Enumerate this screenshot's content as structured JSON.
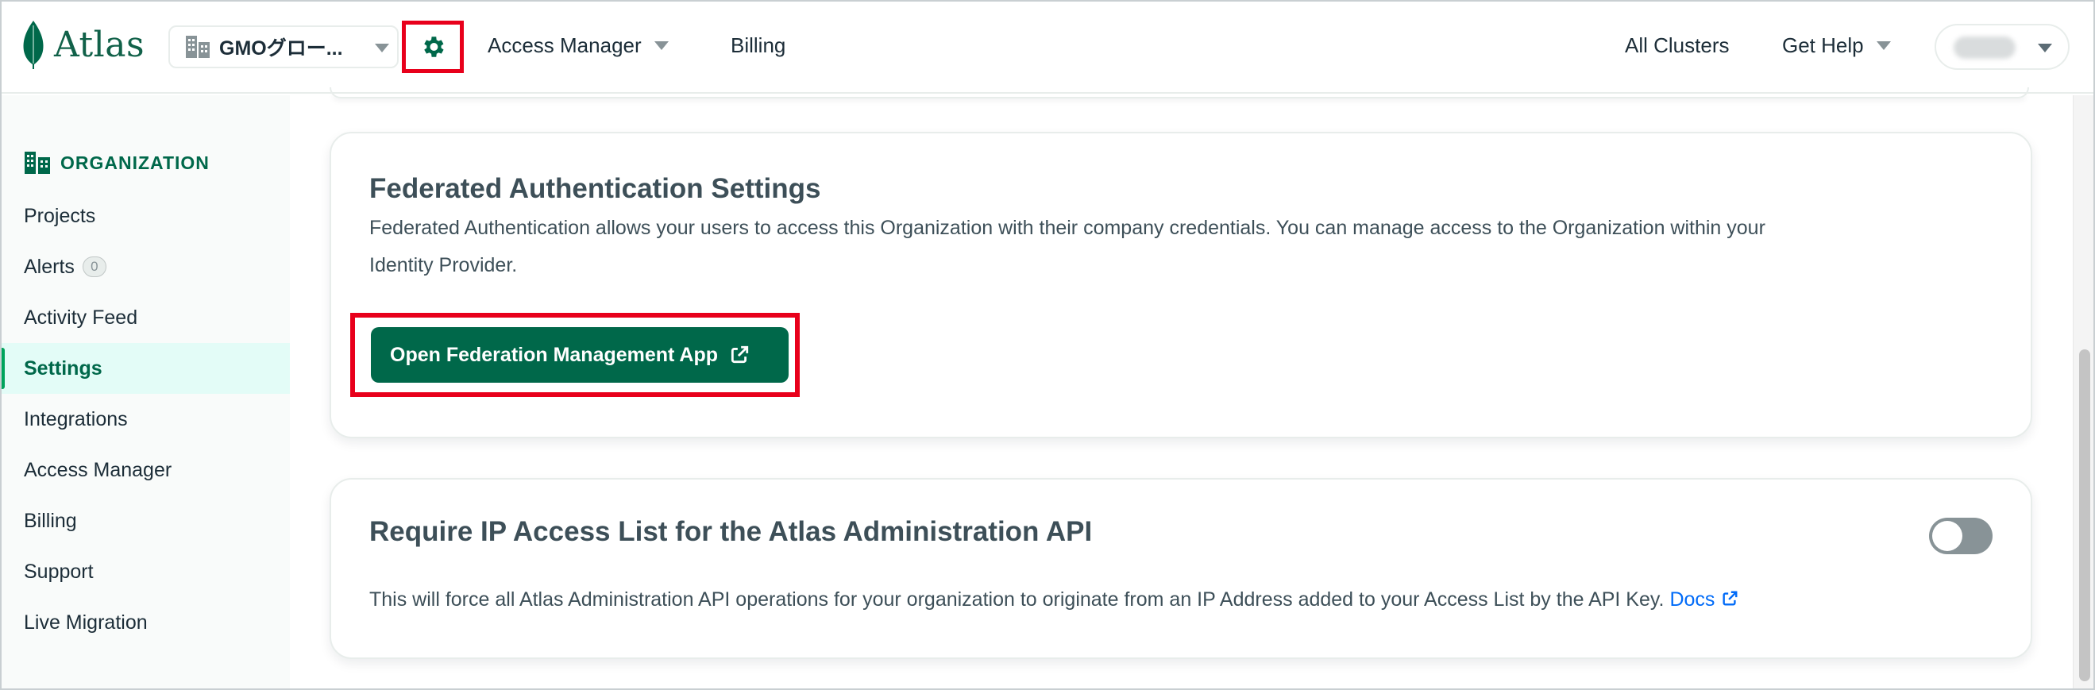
{
  "header": {
    "logo_text": "Atlas",
    "org_name": "GMOグロー...",
    "nav": {
      "access_manager": "Access Manager",
      "billing": "Billing",
      "all_clusters": "All Clusters",
      "get_help": "Get Help"
    }
  },
  "sidebar": {
    "heading": "ORGANIZATION",
    "items": [
      {
        "label": "Projects"
      },
      {
        "label": "Alerts",
        "badge": "0"
      },
      {
        "label": "Activity Feed"
      },
      {
        "label": "Settings",
        "active": true
      },
      {
        "label": "Integrations"
      },
      {
        "label": "Access Manager"
      },
      {
        "label": "Billing"
      },
      {
        "label": "Support"
      },
      {
        "label": "Live Migration"
      }
    ]
  },
  "main": {
    "federated": {
      "title": "Federated Authentication Settings",
      "description_line1": "Federated Authentication allows your users to access this Organization with their company credentials. You can manage access to the Organization within your",
      "description_line2": "Identity Provider.",
      "button_label": "Open Federation Management App"
    },
    "ip_access": {
      "title": "Require IP Access List for the Atlas Administration API",
      "description": "This will force all Atlas Administration API operations for your organization to originate from an IP Address added to your Access List by the API Key. ",
      "docs_link": "Docs",
      "toggle_on": false
    }
  },
  "colors": {
    "brand_green": "#00684a",
    "highlight_red": "#e8001b",
    "link_blue": "#016bf8"
  }
}
